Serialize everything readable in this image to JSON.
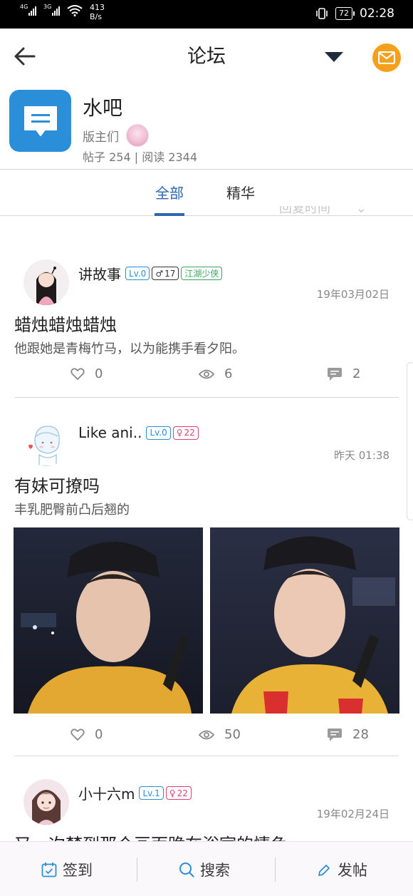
{
  "status_bar": {
    "signal1": "4G",
    "signal2": "3G",
    "speed_value": "413",
    "speed_unit": "B/s",
    "battery": "72",
    "time": "02:28"
  },
  "header": {
    "title": "论坛"
  },
  "forum": {
    "name": "水吧",
    "moderators_label": "版主们",
    "stats": "帖子 254 | 阅读 2344"
  },
  "tabs": [
    {
      "label": "全部",
      "active": true
    },
    {
      "label": "精华",
      "active": false
    }
  ],
  "sort_label": "回复时间",
  "posts": [
    {
      "username": "讲故事",
      "level": "Lv.0",
      "gender_age": "17",
      "rank": "江湖少侠",
      "time": "19年03月02日",
      "title": "蜡烛蜡烛蜡烛",
      "excerpt": "他跟她是青梅竹马，以为能携手看夕阳。",
      "likes": "0",
      "views": "6",
      "comments": "2"
    },
    {
      "username": "Like ani..",
      "level": "Lv.0",
      "gender_age": "22",
      "time": "昨天 01:38",
      "title": "有妹可撩吗",
      "excerpt": "丰乳肥臀前凸后翘的",
      "likes": "0",
      "views": "50",
      "comments": "28"
    },
    {
      "username": "小十六m",
      "level": "Lv.1",
      "gender_age": "22",
      "time": "19年02月24日",
      "title": "又一次梦到那个画面跪在浴室的情色"
    }
  ],
  "bottom_bar": {
    "checkin": "签到",
    "search": "搜索",
    "post": "发帖"
  },
  "colors": {
    "accent_blue": "#2d66b1",
    "forum_icon": "#2b8ed9",
    "mail_button": "#f5a01a",
    "female_badge": "#e0406f",
    "rank_badge": "#3aa55f"
  }
}
